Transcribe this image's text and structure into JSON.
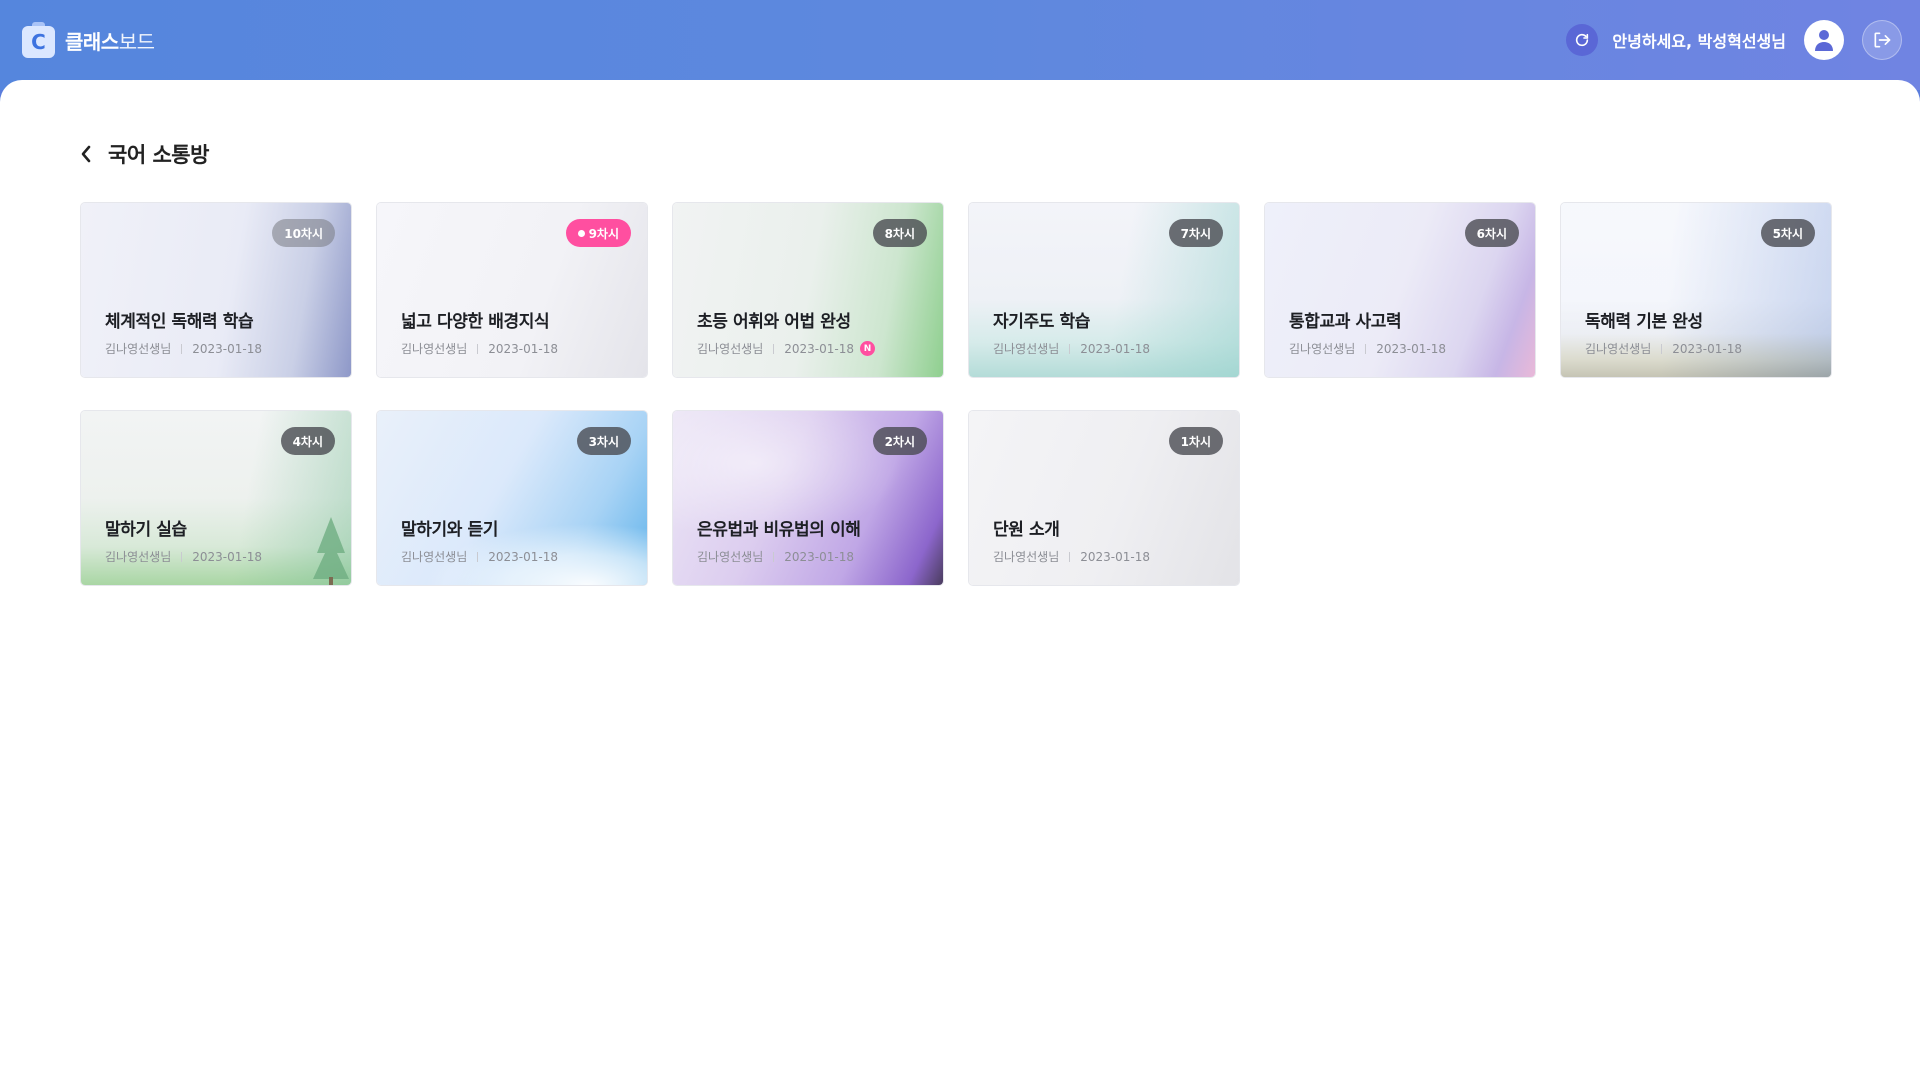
{
  "app": {
    "logo_letter": "C",
    "name_bold": "클래스",
    "name_light": "보드"
  },
  "header": {
    "greeting": "안녕하세요, 박성혁선생님"
  },
  "room": {
    "title": "국어 소통방"
  },
  "cards": [
    {
      "badge": "10차시",
      "title": "체계적인 독해력 학습",
      "teacher": "김나영선생님",
      "date": "2023-01-18"
    },
    {
      "badge": "9차시",
      "title": "넓고 다양한 배경지식",
      "teacher": "김나영선생님",
      "date": "2023-01-18"
    },
    {
      "badge": "8차시",
      "title": "초등 어휘와 어법 완성",
      "teacher": "김나영선생님",
      "date": "2023-01-18",
      "new_label": "N"
    },
    {
      "badge": "7차시",
      "title": "자기주도 학습",
      "teacher": "김나영선생님",
      "date": "2023-01-18"
    },
    {
      "badge": "6차시",
      "title": "통합교과 사고력",
      "teacher": "김나영선생님",
      "date": "2023-01-18"
    },
    {
      "badge": "5차시",
      "title": "독해력 기본 완성",
      "teacher": "김나영선생님",
      "date": "2023-01-18"
    },
    {
      "badge": "4차시",
      "title": "말하기 실습",
      "teacher": "김나영선생님",
      "date": "2023-01-18"
    },
    {
      "badge": "3차시",
      "title": "말하기와 듣기",
      "teacher": "김나영선생님",
      "date": "2023-01-18"
    },
    {
      "badge": "2차시",
      "title": "은유법과 비유법의 이해",
      "teacher": "김나영선생님",
      "date": "2023-01-18"
    },
    {
      "badge": "1차시",
      "title": "단원 소개",
      "teacher": "김나영선생님",
      "date": "2023-01-18"
    }
  ],
  "colors": {
    "live_badge": "#ff4fa0",
    "header_start": "#5586dd",
    "header_end": "#7084e2"
  }
}
